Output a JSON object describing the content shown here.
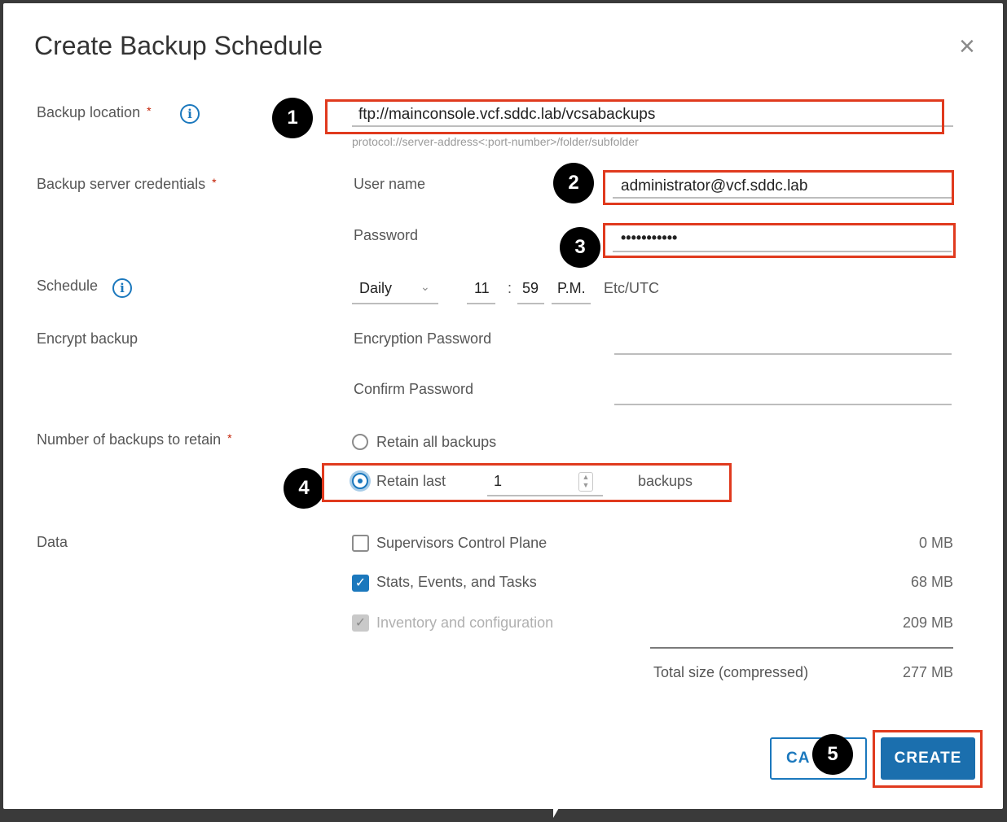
{
  "dialog": {
    "title": "Create Backup Schedule",
    "close_symbol": "×"
  },
  "backup_location": {
    "label": "Backup location",
    "required": "*",
    "value": "ftp://mainconsole.vcf.sddc.lab/vcsabackups",
    "hint": "protocol://server-address<:port-number>/folder/subfolder",
    "icon": "info-icon"
  },
  "credentials": {
    "label": "Backup server credentials",
    "required": "*",
    "username_label": "User name",
    "username_value": "administrator@vcf.sddc.lab",
    "password_label": "Password",
    "password_value": "•••••••••••"
  },
  "schedule": {
    "label": "Schedule",
    "icon": "info-icon",
    "frequency": "Daily",
    "hour": "11",
    "separator": ":",
    "minute": "59",
    "ampm": "P.M.",
    "timezone": "Etc/UTC"
  },
  "encrypt": {
    "label": "Encrypt backup",
    "encryption_password_label": "Encryption Password",
    "confirm_password_label": "Confirm Password"
  },
  "retain": {
    "label": "Number of backups to retain",
    "required": "*",
    "option_all": "Retain all backups",
    "option_last": "Retain last",
    "last_value": "1",
    "suffix": "backups",
    "selected": "Retain last"
  },
  "data": {
    "label": "Data",
    "items": [
      {
        "label": "Supervisors Control Plane",
        "size": "0 MB",
        "checked": false,
        "disabled": false
      },
      {
        "label": "Stats, Events, and Tasks",
        "size": "68 MB",
        "checked": true,
        "disabled": false
      },
      {
        "label": "Inventory and configuration",
        "size": "209 MB",
        "checked": true,
        "disabled": true
      }
    ],
    "total_label": "Total size (compressed)",
    "total_value": "277 MB"
  },
  "buttons": {
    "cancel": "CA",
    "create": "CREATE"
  },
  "markers": [
    "1",
    "2",
    "3",
    "4",
    "5"
  ],
  "colors": {
    "accent": "#1b78bd",
    "highlight_box": "#e03a1e",
    "required": "#c21d00"
  }
}
